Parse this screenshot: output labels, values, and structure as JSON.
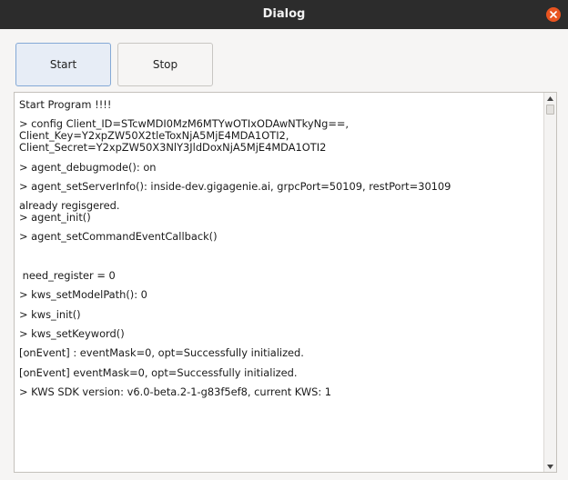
{
  "window": {
    "title": "Dialog"
  },
  "toolbar": {
    "start_label": "Start",
    "stop_label": "Stop"
  },
  "log": {
    "lines": [
      "Start Program !!!!",
      "> config Client_ID=STcwMDI0MzM6MTYwOTIxODAwNTkyNg==,",
      "Client_Key=Y2xpZW50X2tleToxNjA5MjE4MDA1OTI2,",
      "Client_Secret=Y2xpZW50X3NlY3JldDoxNjA5MjE4MDA1OTI2",
      "> agent_debugmode(): on",
      "> agent_setServerInfo(): inside-dev.gigagenie.ai, grpcPort=50109, restPort=30109",
      "already regisgered.",
      "> agent_init()",
      "> agent_setCommandEventCallback()",
      "",
      " need_register = 0",
      "> kws_setModelPath(): 0",
      "> kws_init()",
      "> kws_setKeyword()",
      "[onEvent] : eventMask=0, opt=Successfully initialized.",
      "[onEvent] eventMask=0, opt=Successfully initialized.",
      "> KWS SDK version: v6.0-beta.2-1-g83f5ef8, current KWS: 1"
    ]
  },
  "icons": {
    "close": "close-icon",
    "scroll_up": "arrow-up-icon",
    "scroll_down": "arrow-down-icon"
  },
  "colors": {
    "titlebar": "#2c2c2c",
    "close_button": "#e95420",
    "start_button_focus": "#84a9d6"
  }
}
